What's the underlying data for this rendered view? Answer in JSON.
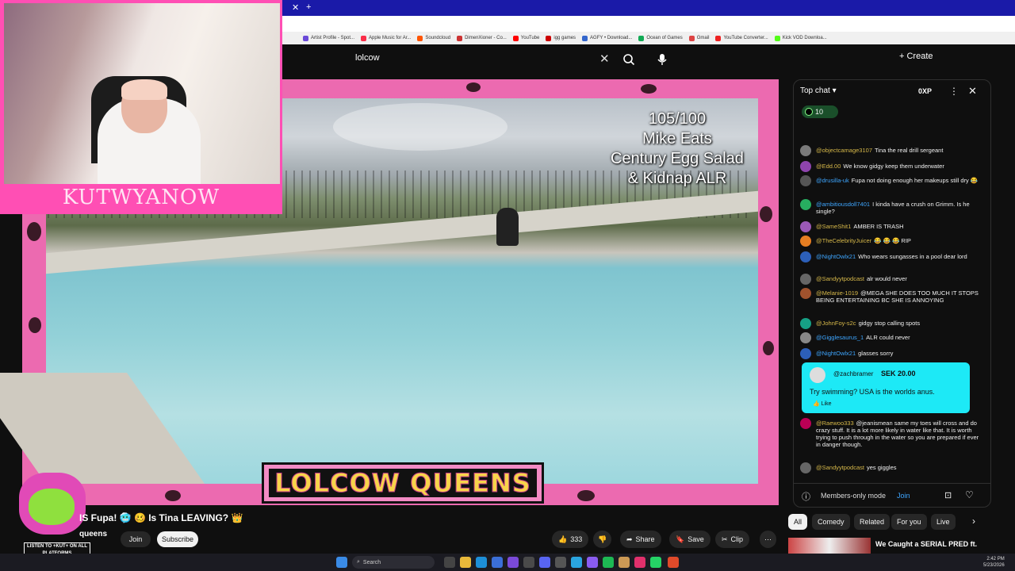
{
  "browser": {
    "bookmarks": [
      "Artist Profile - Spot...",
      "Apple Music for Ar...",
      "Soundcloud",
      "DimenXioner - Co...",
      "YouTube",
      "igg games",
      "AGFY • Download...",
      "Ocean of Games",
      "Gmail",
      "YouTube Converter...",
      "Kick VOD Downloa..."
    ]
  },
  "header": {
    "search_value": "lolcow",
    "create_label": "+ Create"
  },
  "webcam": {
    "name": "KUTWYANOW"
  },
  "player": {
    "overlay_lines": [
      "105/100",
      "Mike Eats",
      "Century Egg Salad",
      "& Kidnap ALR"
    ],
    "banner": "LOLCOW QUEENS"
  },
  "video": {
    "title": "IS Fupa! 🥶 🥴 Is Tina LEAVING? 👑",
    "channel": "queens",
    "join_label": "Join",
    "subscribe_label": "Subscribe",
    "likes": "333",
    "share_label": "Share",
    "save_label": "Save",
    "clip_label": "Clip"
  },
  "mascot": {
    "sign": "LISTEN TO +KUT+ ON ALL PLATFORMS"
  },
  "chat": {
    "header": "Top chat",
    "xp": "0XP",
    "pill_count": "10",
    "messages": [
      {
        "user": "@objectcamage3107",
        "text": "Tina the real drill sergeant",
        "color": "#7a7a7a"
      },
      {
        "user": "@Edd.00",
        "text": "We know gidgy keep them underwater",
        "color": "#8e44ad"
      },
      {
        "user": "@drusilla-uk",
        "text": "Fupa not doing enough her makeups still dry 😂",
        "color": "#555"
      },
      {
        "user": "@ambitiousdoll7401",
        "text": "I kinda have a crush on Grimm. Is he single?",
        "color": "#27ae60"
      },
      {
        "user": "@SameShit1",
        "text": "AMBER IS TRASH",
        "color": "#9b59b6"
      },
      {
        "user": "@TheCelebrityJuicer",
        "text": "😂 😂 😂 RIP",
        "color": "#e67e22"
      },
      {
        "user": "@NightOwlx21",
        "text": "Who wears sungasses in a pool dear lord",
        "color": "#2c5fb8"
      },
      {
        "user": "@Sandyytpodcast",
        "text": "alr would never",
        "color": "#666"
      },
      {
        "user": "@Melanie-1019",
        "text": "@MEGA SHE DOES TOO MUCH IT STOPS BEING ENTERTAINING BC SHE IS ANNOYING",
        "color": "#a0522d"
      },
      {
        "user": "@JohnFoy-s2c",
        "text": "gidgy stop calling spots",
        "color": "#16a085"
      },
      {
        "user": "@Gigglesaurus_1",
        "text": "ALR could never",
        "color": "#888"
      },
      {
        "user": "@NightOwlx21",
        "text": "glasses sorry",
        "color": "#2c5fb8"
      },
      {
        "user": "@Raewoo333",
        "text": "@jeanismean same my toes will cross and do crazy stuff. It is a lot more likely in water like that. It is worth trying to push through in the water so you are prepared if ever in danger though.",
        "color": "#b05"
      },
      {
        "user": "@Sandyytpodcast",
        "text": "yes giggles",
        "color": "#666"
      }
    ],
    "superchat": {
      "user": "@zachbramer",
      "amount": "SEK 20.00",
      "text": "Try swimming? USA is the worlds anus.",
      "like": "Like"
    },
    "members_mode": "Members-only mode",
    "join_label": "Join"
  },
  "chips": [
    "All",
    "Comedy",
    "Related",
    "For you",
    "Live"
  ],
  "recommendation": {
    "title": "We Caught a SERIAL PRED ft."
  },
  "taskbar": {
    "search": "Search",
    "time": "2:42 PM",
    "date": "5/23/2026"
  }
}
